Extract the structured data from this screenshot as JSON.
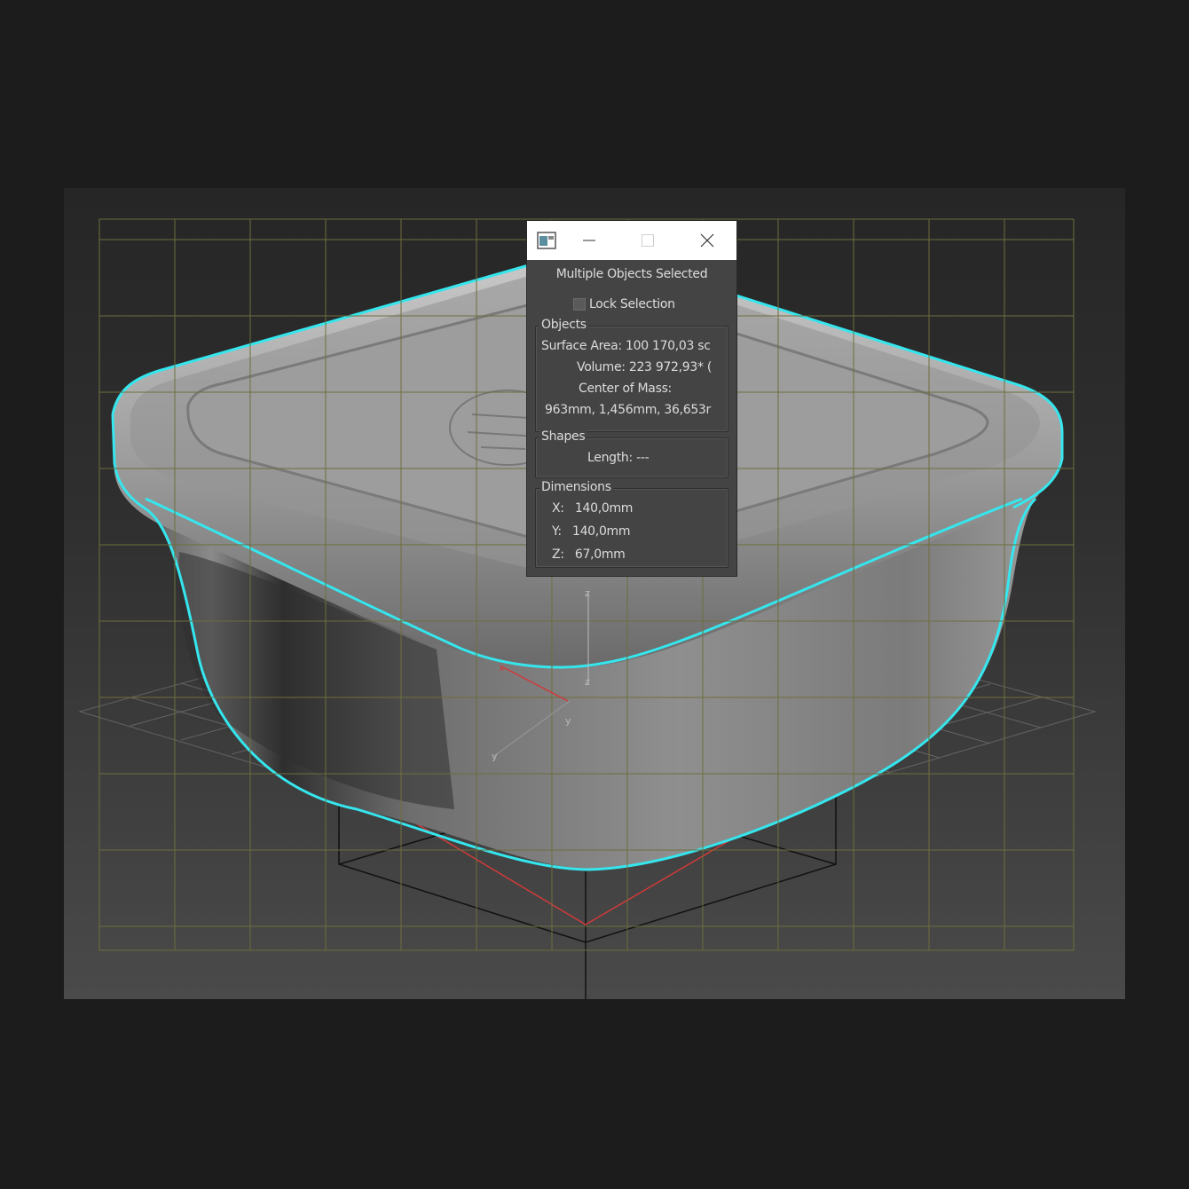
{
  "dialog": {
    "heading": "Multiple Objects Selected",
    "lock_label": "Lock Selection",
    "lock_checked": false,
    "objects": {
      "title": "Objects",
      "surface_area_label": "Surface Area:",
      "surface_area_value": "100 170,03 sc",
      "volume_label": "Volume:",
      "volume_value": "223 972,93* (",
      "center_label": "Center of Mass:",
      "center_value": "963mm, 1,456mm, 36,653r"
    },
    "shapes": {
      "title": "Shapes",
      "length_label": "Length:",
      "length_value": "---"
    },
    "dimensions": {
      "title": "Dimensions",
      "x_label": "X:",
      "x_value": "140,0mm",
      "y_label": "Y:",
      "y_value": "140,0mm",
      "z_label": "Z:",
      "z_value": "67,0mm"
    }
  },
  "gizmo": {
    "x": "x",
    "y": "y",
    "z": "z"
  },
  "colors": {
    "selection_outline": "#35e6ee",
    "grid": "#6e6e3e",
    "gizmo_red": "#d03a3a"
  }
}
